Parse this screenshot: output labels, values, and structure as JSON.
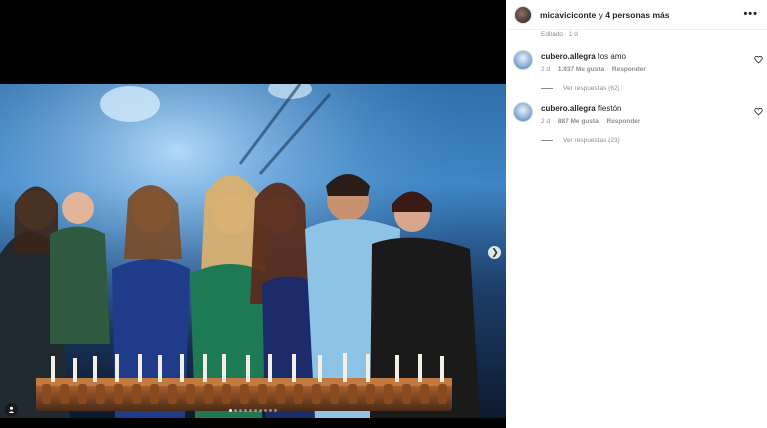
{
  "header": {
    "username": "micaviciconte",
    "conjunction": " y ",
    "others": "4 personas más",
    "more_icon": "more-horizontal-icon",
    "edited": "Editado · 1 d"
  },
  "comments": [
    {
      "username": "cubero.allegra",
      "text": "los amo",
      "age": "2 d",
      "likes": "1.937 Me gusta",
      "reply_label": "Responder",
      "replies_label": "Ver respuestas (62)"
    },
    {
      "username": "cubero.allegra",
      "text": "fiestón",
      "age": "2 d",
      "likes": "887 Me gusta",
      "reply_label": "Responder",
      "replies_label": "Ver respuestas (23)"
    }
  ],
  "media": {
    "image_alt": "group-photo-birthday-cake",
    "next_icon": "chevron-right-icon",
    "tag_icon": "person-tag-icon",
    "slide_count": 10,
    "active_slide": 1
  },
  "colors": {
    "background": "#ffffff",
    "text": "#262626",
    "secondary_text": "#8e8e8e",
    "media_background": "#000000"
  }
}
